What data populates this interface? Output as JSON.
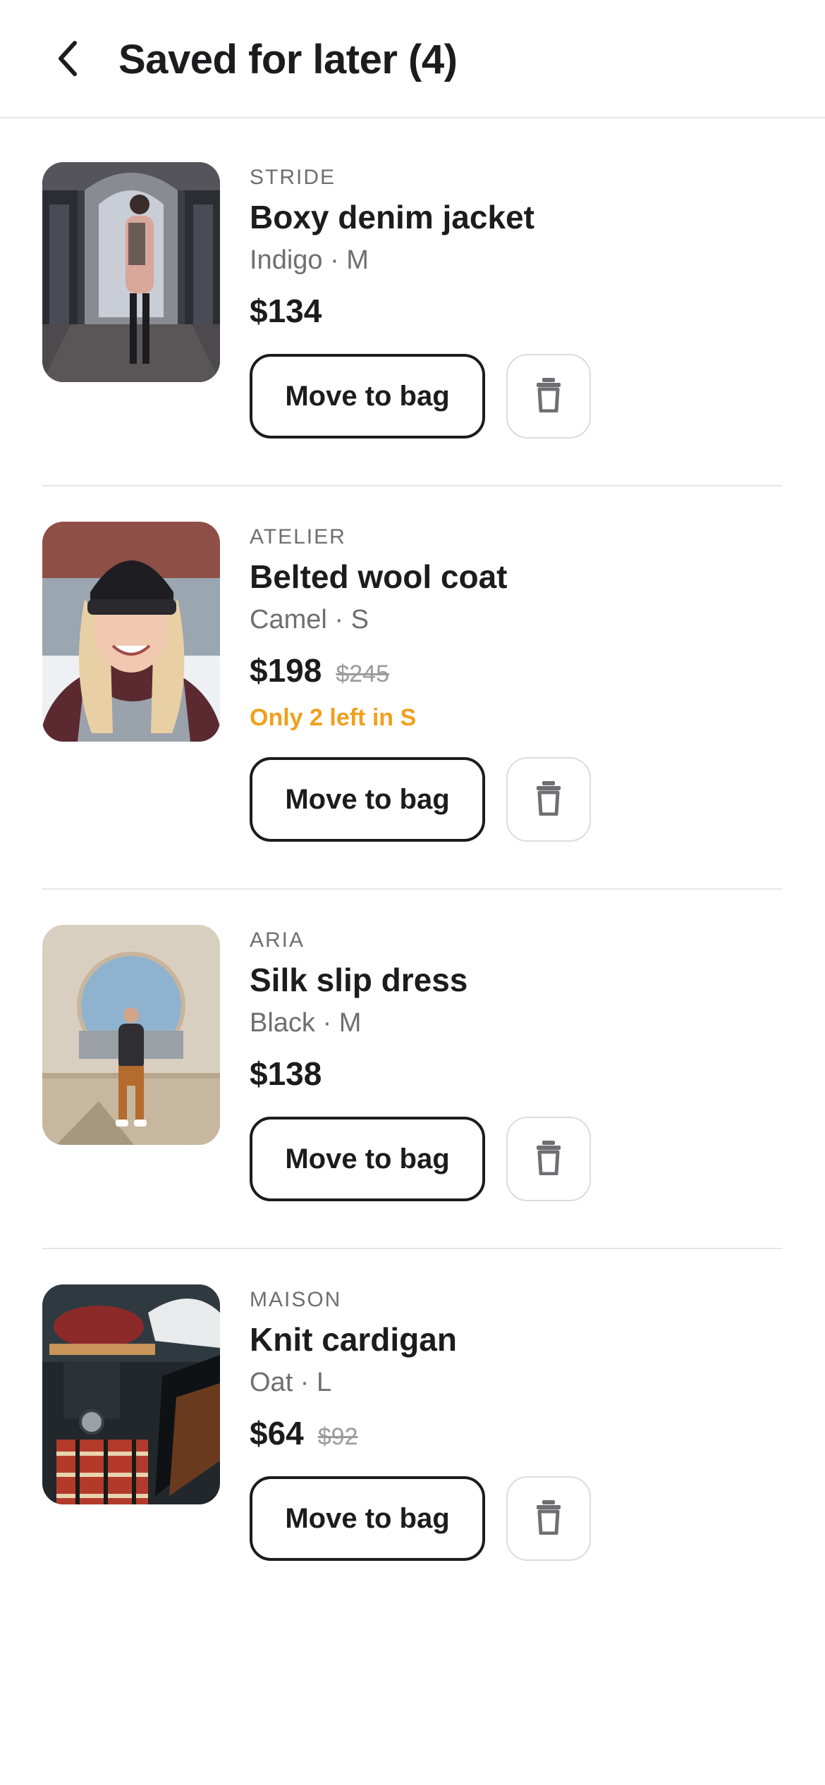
{
  "header": {
    "back_icon": "chevron-left-icon",
    "title": "Saved for later (4)"
  },
  "colors": {
    "text": "#1c1c1e",
    "muted": "#6e6e73",
    "strike": "#9b9b9f",
    "stock_warning": "#f0a01e",
    "divider": "#e6e6e6"
  },
  "items": [
    {
      "brand": "STRIDE",
      "name": "Boxy denim jacket",
      "variant": "Indigo · M",
      "price": "$134",
      "price_old": "",
      "stock_note": "",
      "move_label": "Move to bag",
      "delete_icon": "trash-icon"
    },
    {
      "brand": "ATELIER",
      "name": "Belted wool coat",
      "variant": "Camel · S",
      "price": "$198",
      "price_old": "$245",
      "stock_note": "Only 2 left in S",
      "move_label": "Move to bag",
      "delete_icon": "trash-icon"
    },
    {
      "brand": "ARIA",
      "name": "Silk slip dress",
      "variant": "Black · M",
      "price": "$138",
      "price_old": "",
      "stock_note": "",
      "move_label": "Move to bag",
      "delete_icon": "trash-icon"
    },
    {
      "brand": "MAISON",
      "name": "Knit cardigan",
      "variant": "Oat · L",
      "price": "$64",
      "price_old": "$92",
      "stock_note": "",
      "move_label": "Move to bag",
      "delete_icon": "trash-icon"
    }
  ]
}
